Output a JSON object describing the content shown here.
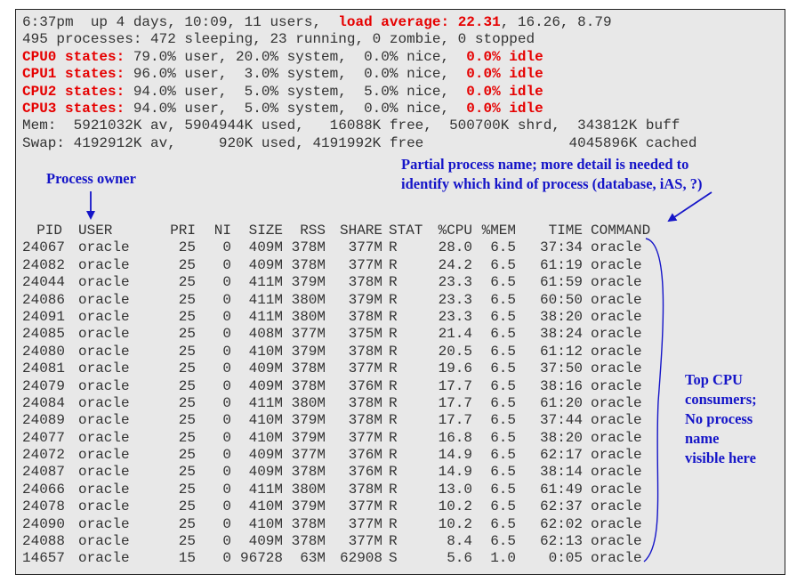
{
  "summary": {
    "line1_pre": "6:37pm  up 4 days, 10:09, 11 users,  ",
    "load_label": "load average:",
    "load1": "22.31",
    "line1_post": ", 16.26, 8.79",
    "line2": "495 processes: 472 sleeping, 23 running, 0 zombie, 0 stopped",
    "cpus": [
      {
        "label": "CPU0 states:",
        "stats": " 79.0% user, 20.0% system,  0.0% nice,  ",
        "idle": "0.0% idle"
      },
      {
        "label": "CPU1 states:",
        "stats": " 96.0% user,  3.0% system,  0.0% nice,  ",
        "idle": "0.0% idle"
      },
      {
        "label": "CPU2 states:",
        "stats": " 94.0% user,  5.0% system,  5.0% nice,  ",
        "idle": "0.0% idle"
      },
      {
        "label": "CPU3 states:",
        "stats": " 94.0% user,  5.0% system,  0.0% nice,  ",
        "idle": "0.0% idle"
      }
    ],
    "mem": "Mem:  5921032K av, 5904944K used,   16088K free,  500700K shrd,  343812K buff",
    "swap": "Swap: 4192912K av,     920K used, 4191992K free                 4045896K cached"
  },
  "annotations": {
    "owner": "Process owner",
    "partial_line1": "Partial process name; more detail is needed to",
    "partial_line2": "identify which kind of process (database, iAS, ?)",
    "top_cpu": [
      "Top CPU",
      "consumers;",
      "No process",
      "name",
      "visible here"
    ]
  },
  "table": {
    "headers": [
      "PID",
      "USER",
      "PRI",
      "NI",
      "SIZE",
      "RSS",
      "SHARE",
      "STAT",
      "%CPU",
      "%MEM",
      "TIME",
      "COMMAND"
    ],
    "rows": [
      [
        "24067",
        "oracle",
        "25",
        "0",
        "409M",
        "378M",
        "377M",
        "R",
        "28.0",
        "6.5",
        "37:34",
        "oracle"
      ],
      [
        "24082",
        "oracle",
        "25",
        "0",
        "409M",
        "378M",
        "377M",
        "R",
        "24.2",
        "6.5",
        "61:19",
        "oracle"
      ],
      [
        "24044",
        "oracle",
        "25",
        "0",
        "411M",
        "379M",
        "378M",
        "R",
        "23.3",
        "6.5",
        "61:59",
        "oracle"
      ],
      [
        "24086",
        "oracle",
        "25",
        "0",
        "411M",
        "380M",
        "379M",
        "R",
        "23.3",
        "6.5",
        "60:50",
        "oracle"
      ],
      [
        "24091",
        "oracle",
        "25",
        "0",
        "411M",
        "380M",
        "378M",
        "R",
        "23.3",
        "6.5",
        "38:20",
        "oracle"
      ],
      [
        "24085",
        "oracle",
        "25",
        "0",
        "408M",
        "377M",
        "375M",
        "R",
        "21.4",
        "6.5",
        "38:24",
        "oracle"
      ],
      [
        "24080",
        "oracle",
        "25",
        "0",
        "410M",
        "379M",
        "378M",
        "R",
        "20.5",
        "6.5",
        "61:12",
        "oracle"
      ],
      [
        "24081",
        "oracle",
        "25",
        "0",
        "409M",
        "378M",
        "377M",
        "R",
        "19.6",
        "6.5",
        "37:50",
        "oracle"
      ],
      [
        "24079",
        "oracle",
        "25",
        "0",
        "409M",
        "378M",
        "376M",
        "R",
        "17.7",
        "6.5",
        "38:16",
        "oracle"
      ],
      [
        "24084",
        "oracle",
        "25",
        "0",
        "411M",
        "380M",
        "378M",
        "R",
        "17.7",
        "6.5",
        "61:20",
        "oracle"
      ],
      [
        "24089",
        "oracle",
        "25",
        "0",
        "410M",
        "379M",
        "378M",
        "R",
        "17.7",
        "6.5",
        "37:44",
        "oracle"
      ],
      [
        "24077",
        "oracle",
        "25",
        "0",
        "410M",
        "379M",
        "377M",
        "R",
        "16.8",
        "6.5",
        "38:20",
        "oracle"
      ],
      [
        "24072",
        "oracle",
        "25",
        "0",
        "409M",
        "377M",
        "376M",
        "R",
        "14.9",
        "6.5",
        "62:17",
        "oracle"
      ],
      [
        "24087",
        "oracle",
        "25",
        "0",
        "409M",
        "378M",
        "376M",
        "R",
        "14.9",
        "6.5",
        "38:14",
        "oracle"
      ],
      [
        "24066",
        "oracle",
        "25",
        "0",
        "411M",
        "380M",
        "378M",
        "R",
        "13.0",
        "6.5",
        "61:49",
        "oracle"
      ],
      [
        "24078",
        "oracle",
        "25",
        "0",
        "410M",
        "379M",
        "377M",
        "R",
        "10.2",
        "6.5",
        "62:37",
        "oracle"
      ],
      [
        "24090",
        "oracle",
        "25",
        "0",
        "410M",
        "378M",
        "377M",
        "R",
        "10.2",
        "6.5",
        "62:02",
        "oracle"
      ],
      [
        "24088",
        "oracle",
        "25",
        "0",
        "409M",
        "378M",
        "377M",
        "R",
        "8.4",
        "6.5",
        "62:13",
        "oracle"
      ],
      [
        "14657",
        "oracle",
        "15",
        "0",
        "96728",
        "63M",
        "62908",
        "S",
        "5.6",
        "1.0",
        "0:05",
        "oracle"
      ]
    ]
  }
}
